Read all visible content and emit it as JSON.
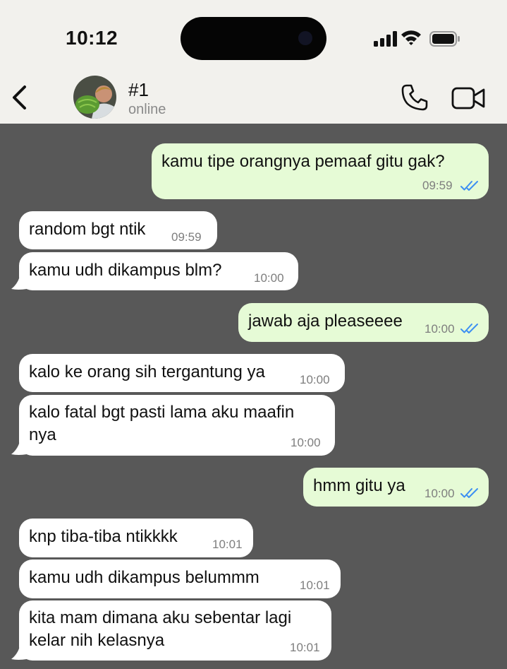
{
  "status_bar": {
    "time": "10:12",
    "icons": [
      "cellular-signal-icon",
      "wifi-icon",
      "battery-icon"
    ]
  },
  "header": {
    "back_icon": "chevron-left-icon",
    "contact_name": "#1",
    "contact_status": "online",
    "call_icon": "phone-icon",
    "video_icon": "video-camera-icon"
  },
  "colors": {
    "header_bg": "#f2f1ed",
    "chat_bg": "#585858",
    "incoming_bubble": "#ffffff",
    "outgoing_bubble": "#e6fbd6",
    "read_ticks": "#3d8ff2"
  },
  "messages": [
    {
      "direction": "out",
      "text": "kamu tipe orangnya pemaaf gitu gak?",
      "time": "09:59",
      "status": "read"
    },
    {
      "direction": "in",
      "text": "random bgt ntik",
      "time": "09:59"
    },
    {
      "direction": "in",
      "text": "kamu udh dikampus blm?",
      "time": "10:00"
    },
    {
      "direction": "out",
      "text": "jawab aja pleaseeee",
      "time": "10:00",
      "status": "read"
    },
    {
      "direction": "in",
      "text": "kalo ke orang sih tergantung ya",
      "time": "10:00"
    },
    {
      "direction": "in",
      "text": "kalo fatal bgt pasti lama aku maafin nya",
      "time": "10:00"
    },
    {
      "direction": "out",
      "text": "hmm gitu ya",
      "time": "10:00",
      "status": "read"
    },
    {
      "direction": "in",
      "text": "knp tiba-tiba ntikkkk",
      "time": "10:01"
    },
    {
      "direction": "in",
      "text": "kamu udh dikampus belummm",
      "time": "10:01"
    },
    {
      "direction": "in",
      "text": "kita mam dimana aku sebentar lagi kelar nih kelasnya",
      "time": "10:01"
    }
  ]
}
